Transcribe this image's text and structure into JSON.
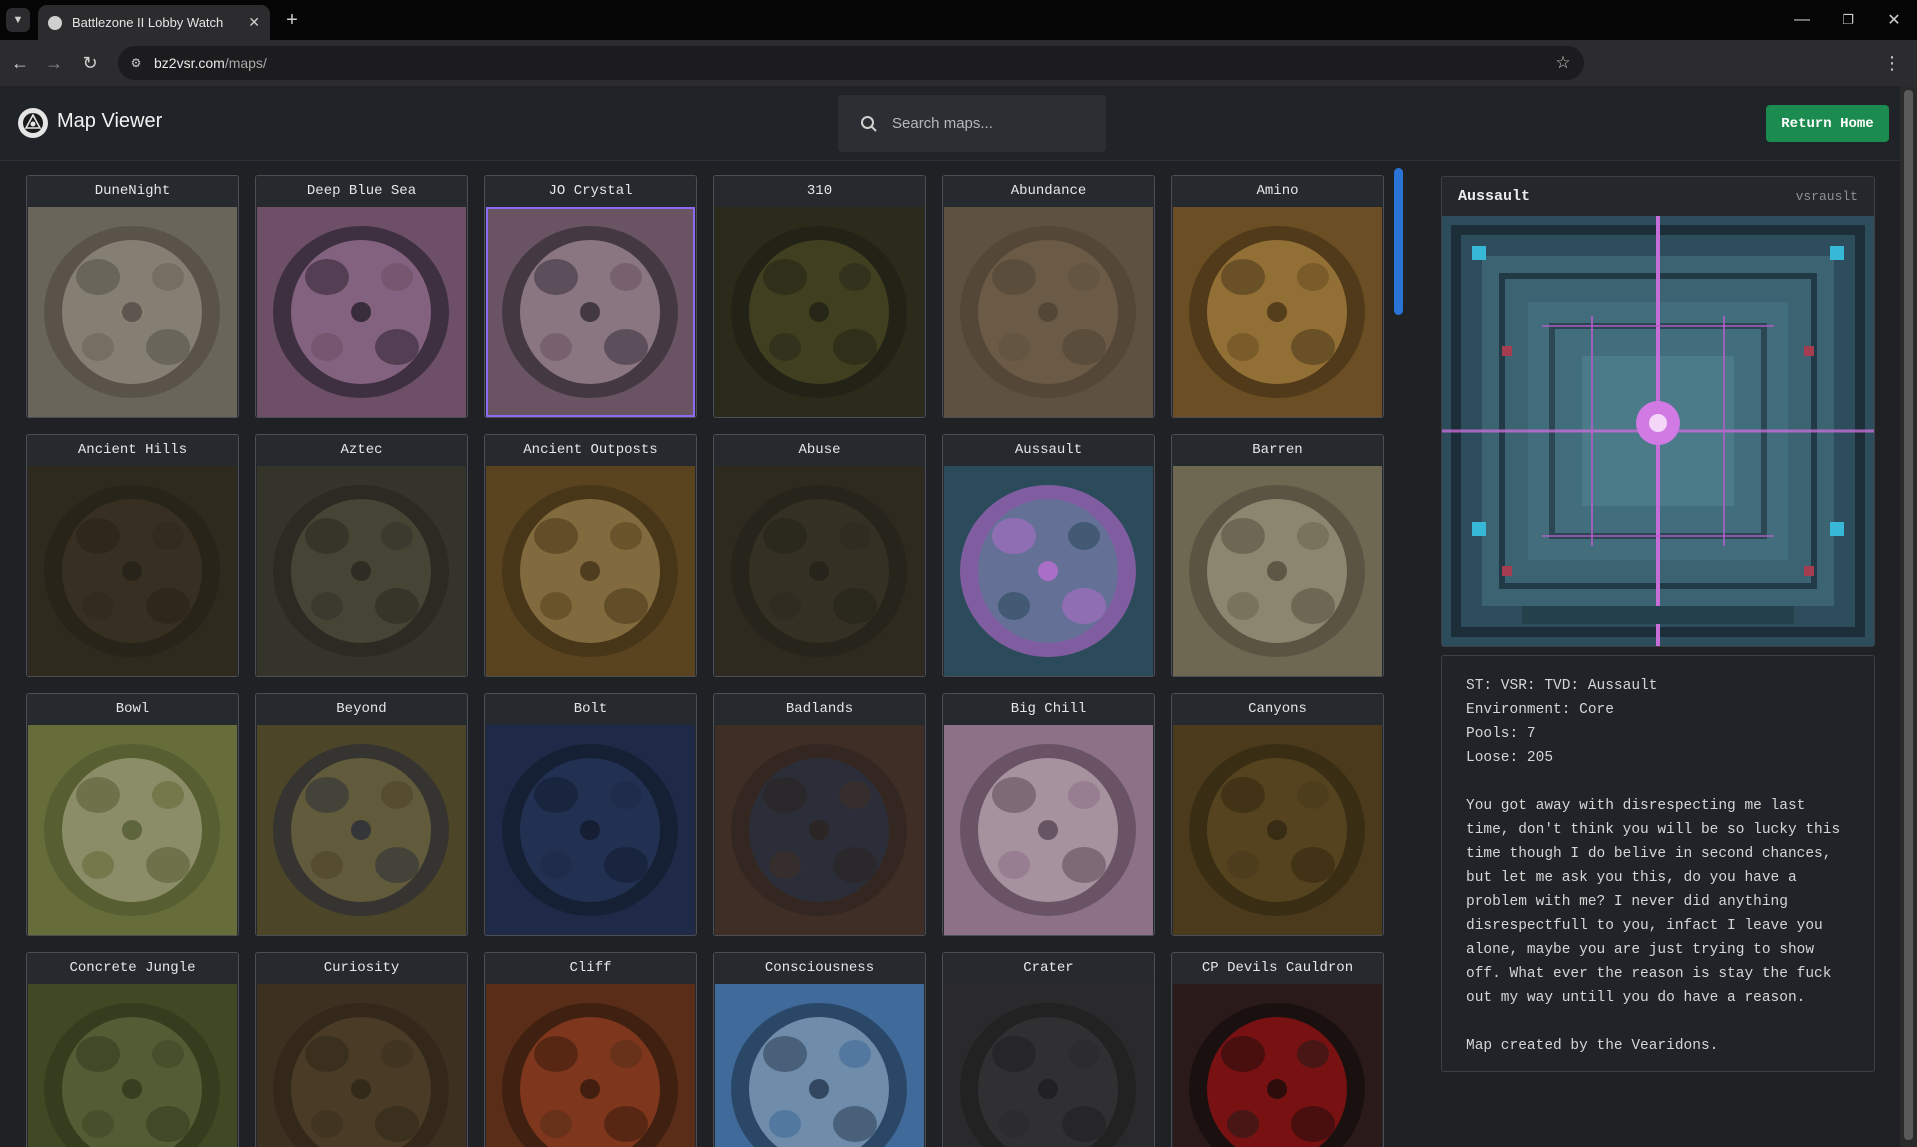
{
  "browser": {
    "tab_title": "Battlezone II Lobby Watch",
    "url_host": "bz2vsr.com",
    "url_path": "/maps/"
  },
  "header": {
    "title": "Map Viewer",
    "search_placeholder": "Search maps...",
    "return_label": "Return Home"
  },
  "maps": [
    {
      "name": "DuneNight",
      "palette": [
        "#6a655a",
        "#a9a393",
        "#4a463e"
      ]
    },
    {
      "name": "Deep Blue Sea",
      "palette": [
        "#6d5068",
        "#b98db0",
        "#1a1520"
      ]
    },
    {
      "name": "JO Crystal",
      "palette": [
        "#6a5463",
        "#c4a9b5",
        "#24202a"
      ],
      "selected": true
    },
    {
      "name": "310",
      "palette": [
        "#2b2a1b",
        "#5a5a28",
        "#1d1c14"
      ]
    },
    {
      "name": "Abundance",
      "palette": [
        "#5f5140",
        "#7b6a52",
        "#4a3f31"
      ]
    },
    {
      "name": "Amino",
      "palette": [
        "#6b4e23",
        "#c99a4c",
        "#3a2a13"
      ]
    },
    {
      "name": "Ancient Hills",
      "palette": [
        "#2f2a1e",
        "#433a29",
        "#241f16"
      ]
    },
    {
      "name": "Aztec",
      "palette": [
        "#35342a",
        "#5d5a45",
        "#25241d"
      ]
    },
    {
      "name": "Ancient Outposts",
      "palette": [
        "#5a4420",
        "#b0955c",
        "#3b2b12"
      ]
    },
    {
      "name": "Abuse",
      "palette": [
        "#2e2a20",
        "#3f3a2a",
        "#221f18"
      ]
    },
    {
      "name": "Aussault",
      "palette": [
        "#2b4b5b",
        "#4f7f8f",
        "#c66dd8"
      ]
    },
    {
      "name": "Barren",
      "palette": [
        "#6e6852",
        "#b3ae96",
        "#4a4434"
      ]
    },
    {
      "name": "Bowl",
      "palette": [
        "#666d3a",
        "#b7b596",
        "#4b5229"
      ]
    },
    {
      "name": "Beyond",
      "palette": [
        "#4c4527",
        "#857a46",
        "#222738"
      ]
    },
    {
      "name": "Bolt",
      "palette": [
        "#1e2a47",
        "#2e3f6a",
        "#101726"
      ]
    },
    {
      "name": "Badlands",
      "palette": [
        "#3e2e26",
        "#24354c",
        "#2c221d"
      ]
    },
    {
      "name": "Big Chill",
      "palette": [
        "#8d7287",
        "#d9c4d0",
        "#4d3b48"
      ]
    },
    {
      "name": "Canyons",
      "palette": [
        "#4b3b1c",
        "#6b5526",
        "#2c220f"
      ]
    },
    {
      "name": "Concrete Jungle",
      "palette": [
        "#3f4a25",
        "#6c7748",
        "#2c3319"
      ]
    },
    {
      "name": "Curiosity",
      "palette": [
        "#3c3020",
        "#5b4a30",
        "#2b2316"
      ]
    },
    {
      "name": "Cliff",
      "palette": [
        "#5a2d18",
        "#b04a28",
        "#2b150c"
      ]
    },
    {
      "name": "Consciousness",
      "palette": [
        "#3f6a99",
        "#a8c5e0",
        "#1a2a40"
      ]
    },
    {
      "name": "Crater",
      "palette": [
        "#2a2a2c",
        "#3d3d40",
        "#1b1b1d"
      ]
    },
    {
      "name": "CP Devils Cauldron",
      "palette": [
        "#2a1a1a",
        "#c41313",
        "#0f0a0a"
      ]
    }
  ],
  "detail": {
    "title": "Aussault",
    "filename": "vsrauslt",
    "info_lines": [
      "ST: VSR: TVD: Aussault",
      "Environment: Core",
      "Pools: 7",
      "Loose: 205"
    ],
    "description": "You got away with disrespecting me last time, don't think you will be so lucky this time though I do belive in second chances, but let me ask you this, do you have a problem with me? I never did anything disrespectfull to you, infact I leave you alone, maybe you are just trying to show off. What ever the reason is stay the fuck out my way untill you do have a reason.",
    "credit": "Map created by the Vearidons."
  }
}
